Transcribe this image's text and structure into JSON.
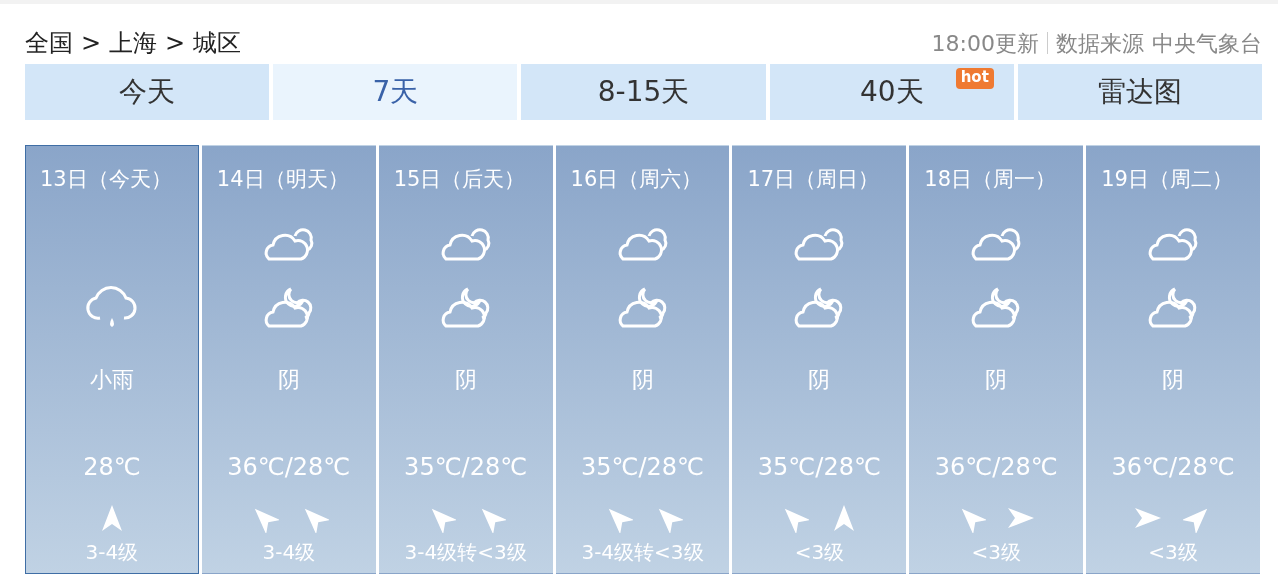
{
  "breadcrumb": [
    "全国",
    ">",
    "上海",
    ">",
    "城区"
  ],
  "update_time": "18:00更新",
  "source_label": "数据来源",
  "source": "中央气象台",
  "tabs": [
    {
      "label": "今天",
      "selected": false
    },
    {
      "label": "7天",
      "selected": true
    },
    {
      "label": "8-15天",
      "selected": false
    },
    {
      "label": "40天",
      "selected": false,
      "badge": "hot"
    },
    {
      "label": "雷达图",
      "selected": false
    }
  ],
  "days": [
    {
      "title": "13日（今天）",
      "selected": true,
      "night_icon": {
        "kind": "rain"
      },
      "weather": "小雨",
      "temperature": "28℃",
      "wind_arrows": [
        {
          "kind": "up"
        }
      ],
      "wind": "3-4级"
    },
    {
      "title": "14日（明天）",
      "selected": false,
      "day_icon": {
        "kind": "cloudy"
      },
      "night_icon": {
        "kind": "moon"
      },
      "weather": "阴",
      "temperature": "36℃/28℃",
      "wind_arrows": [
        {
          "kind": "upleft"
        },
        {
          "kind": "upleft"
        }
      ],
      "wind": "3-4级"
    },
    {
      "title": "15日（后天）",
      "selected": false,
      "day_icon": {
        "kind": "cloudy"
      },
      "night_icon": {
        "kind": "moon"
      },
      "weather": "阴",
      "temperature": "35℃/28℃",
      "wind_arrows": [
        {
          "kind": "upleft"
        },
        {
          "kind": "upleft"
        }
      ],
      "wind": "3-4级转<3级"
    },
    {
      "title": "16日（周六）",
      "selected": false,
      "day_icon": {
        "kind": "cloudy"
      },
      "night_icon": {
        "kind": "moon"
      },
      "weather": "阴",
      "temperature": "35℃/28℃",
      "wind_arrows": [
        {
          "kind": "upleft"
        },
        {
          "kind": "upleft"
        }
      ],
      "wind": "3-4级转<3级"
    },
    {
      "title": "17日（周日）",
      "selected": false,
      "day_icon": {
        "kind": "cloudy"
      },
      "night_icon": {
        "kind": "moon"
      },
      "weather": "阴",
      "temperature": "35℃/28℃",
      "wind_arrows": [
        {
          "kind": "upleft"
        },
        {
          "kind": "up"
        }
      ],
      "wind": "<3级"
    },
    {
      "title": "18日（周一）",
      "selected": false,
      "day_icon": {
        "kind": "cloudy"
      },
      "night_icon": {
        "kind": "moon"
      },
      "weather": "阴",
      "temperature": "36℃/28℃",
      "wind_arrows": [
        {
          "kind": "upleft"
        },
        {
          "kind": "right"
        }
      ],
      "wind": "<3级"
    },
    {
      "title": "19日（周二）",
      "selected": false,
      "day_icon": {
        "kind": "cloudy"
      },
      "night_icon": {
        "kind": "moon"
      },
      "weather": "阴",
      "temperature": "36℃/28℃",
      "wind_arrows": [
        {
          "kind": "right"
        },
        {
          "kind": "upright"
        }
      ],
      "wind": "<3级"
    }
  ]
}
